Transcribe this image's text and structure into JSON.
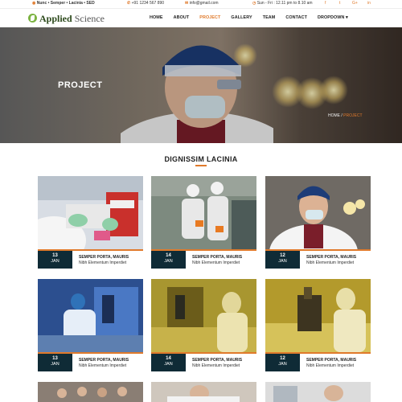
{
  "topbar": {
    "address": "Nunc • Semper • Lacinia • SED",
    "phone": "+91 1234 567 890",
    "email": "info@gmail.com",
    "hours": "Sun - Fri : 12.11 pm to 8.10 am",
    "social": [
      "f",
      "t",
      "G+",
      "in"
    ]
  },
  "brand": {
    "name_bold": "Applied",
    "name_rest": " Science"
  },
  "menu": [
    "HOME",
    "ABOUT",
    "PROJECT",
    "GALLERY",
    "TEAM",
    "CONTACT",
    "DROPDOWN ▾"
  ],
  "hero": {
    "title": "PROJECT",
    "crumb_home": "HOME",
    "crumb_sep": " / ",
    "crumb_current": "PROJECT"
  },
  "section_title": "DIGNISSIM LACINIA",
  "cards": [
    {
      "day": "13",
      "month": "JAN",
      "title": "SEMPER PORTA, MAURIS",
      "subtitle": "Nibh Elementum Imperdiet"
    },
    {
      "day": "14",
      "month": "JAN",
      "title": "SEMPER PORTA, MAURIS",
      "subtitle": "Nibh Elementum Imperdiet"
    },
    {
      "day": "12",
      "month": "JAN",
      "title": "SEMPER PORTA, MAURIS",
      "subtitle": "Nibh Elementum Imperdiet"
    },
    {
      "day": "13",
      "month": "JAN",
      "title": "SEMPER PORTA, MAURIS",
      "subtitle": "Nibh Elementum Imperdiet"
    },
    {
      "day": "14",
      "month": "JAN",
      "title": "SEMPER PORTA, MAURIS",
      "subtitle": "Nibh Elementum Imperdiet"
    },
    {
      "day": "12",
      "month": "JAN",
      "title": "SEMPER PORTA, MAURIS",
      "subtitle": "Nibh Elementum Imperdiet"
    }
  ],
  "colors": {
    "accent": "#e07a2b",
    "date_bg": "#0f2b36",
    "logo_green": "#7cb342"
  }
}
